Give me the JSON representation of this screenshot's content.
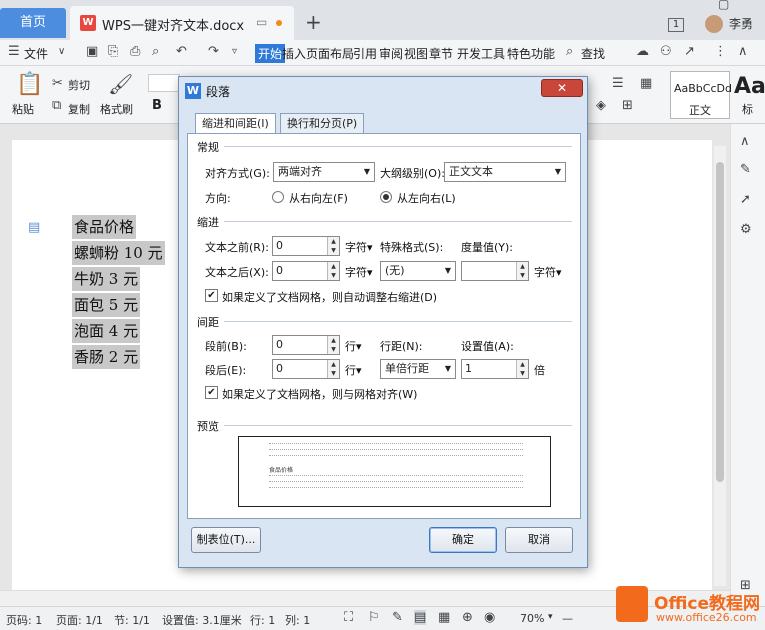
{
  "tabs": {
    "home": "首页",
    "doc_logo": "W",
    "doc_title": "WPS一键对齐文本.docx",
    "add": "+"
  },
  "account": {
    "badge": "1",
    "name": "李勇"
  },
  "menu": {
    "file": "文件",
    "items": [
      "开始",
      "插入",
      "页面布局",
      "引用",
      "审阅",
      "视图",
      "章节",
      "开发工具",
      "特色功能"
    ],
    "search": "查找"
  },
  "ribbon": {
    "paste": "粘贴",
    "cut": "剪切",
    "copy": "复制",
    "format_painter": "格式刷",
    "bold": "B",
    "style_preview": "AaBbCcDd",
    "style_name": "正文",
    "style2_preview": "Aa",
    "style2_name": "标"
  },
  "document": {
    "lines": [
      "食品价格",
      "螺蛳粉 10 元",
      "牛奶 3 元",
      "面包 5 元",
      "泡面 4 元",
      "香肠 2 元"
    ]
  },
  "dialog": {
    "icon": "W",
    "title": "段落",
    "close": "✕",
    "tabs": [
      "缩进和间距(I)",
      "换行和分页(P)"
    ],
    "general": {
      "title": "常规",
      "alignment_label": "对齐方式(G):",
      "alignment_value": "两端对齐",
      "outline_label": "大纲级别(O):",
      "outline_value": "正文文本",
      "direction_label": "方向:",
      "rtl_label": "从右向左(F)",
      "ltr_label": "从左向右(L)"
    },
    "indent": {
      "title": "缩进",
      "before_label": "文本之前(R):",
      "before_value": "0",
      "before_unit": "字符▾",
      "after_label": "文本之后(X):",
      "after_value": "0",
      "after_unit": "字符▾",
      "special_label": "特殊格式(S):",
      "special_value": "(无)",
      "measure_label": "度量值(Y):",
      "measure_value": "",
      "measure_unit": "字符▾",
      "grid_checkbox": "如果定义了文档网格，则自动调整右缩进(D)"
    },
    "spacing": {
      "title": "间距",
      "before_label": "段前(B):",
      "before_value": "0",
      "before_unit": "行▾",
      "after_label": "段后(E):",
      "after_value": "0",
      "after_unit": "行▾",
      "line_label": "行距(N):",
      "line_value": "单倍行距",
      "set_label": "设置值(A):",
      "set_value": "1",
      "set_unit": "倍",
      "grid_checkbox": "如果定义了文档网格，则与网格对齐(W)"
    },
    "preview": {
      "title": "预览",
      "sample": "食品价格"
    },
    "buttons": {
      "tabs": "制表位(T)...",
      "ok": "确定",
      "cancel": "取消"
    }
  },
  "status": {
    "page_no": "页码: 1",
    "pages": "页面: 1/1",
    "section": "节: 1/1",
    "setting": "设置值: 3.1厘米",
    "row": "行: 1",
    "col": "列: 1",
    "zoom": "70%"
  },
  "watermark": {
    "brand": "Office教程网",
    "url": "www.office26.com"
  },
  "colors": {
    "accent": "#2f7ad8",
    "home_tab": "#4c8de0",
    "close": "#c9463a",
    "watermark": "#f26b1d"
  }
}
